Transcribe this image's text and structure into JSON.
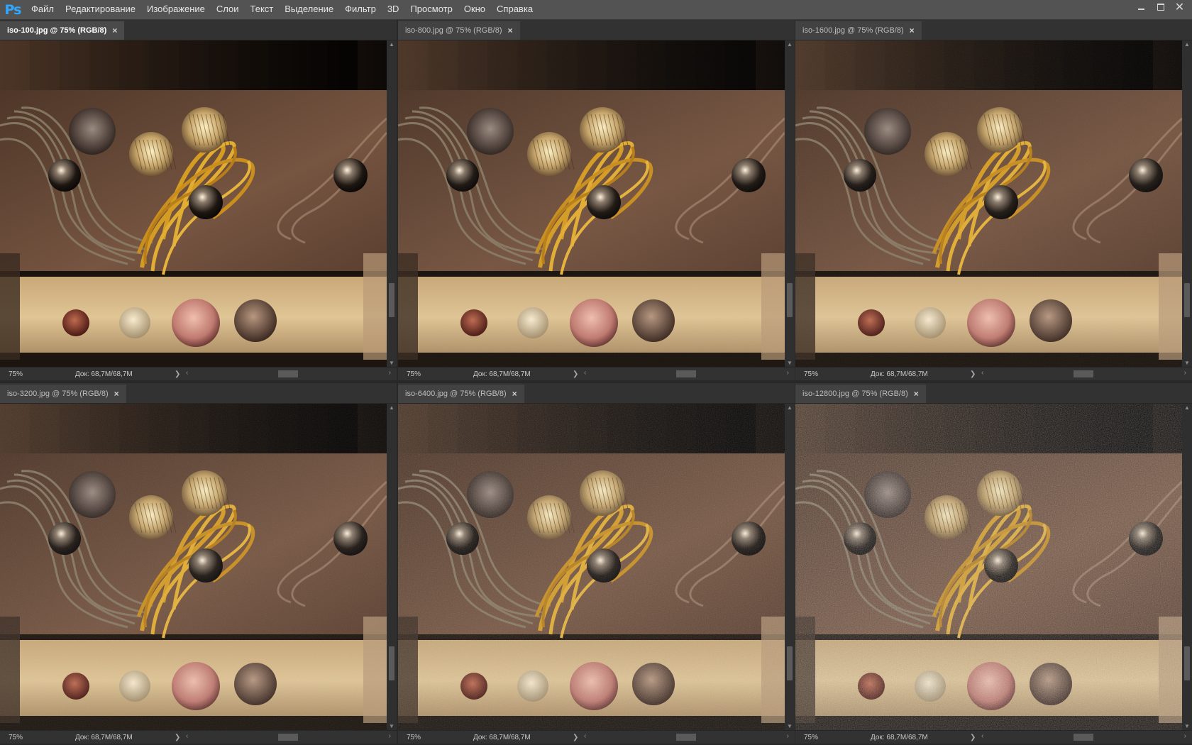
{
  "app": {
    "logo": "Ps",
    "menu": [
      "Файл",
      "Редактирование",
      "Изображение",
      "Слои",
      "Текст",
      "Выделение",
      "Фильтр",
      "3D",
      "Просмотр",
      "Окно",
      "Справка"
    ]
  },
  "window_controls": {
    "minimize": "minimize-icon",
    "restore": "restore-icon",
    "close": "✕"
  },
  "documents": [
    {
      "title": "iso-100.jpg @ 75% (RGB/8)",
      "close": "×",
      "zoom": "75%",
      "doc_size": "Док: 68,7M/68,7M",
      "active": true,
      "noise": 0
    },
    {
      "title": "iso-800.jpg @ 75% (RGB/8)",
      "close": "×",
      "zoom": "75%",
      "doc_size": "Док: 68,7M/68,7M",
      "active": false,
      "noise": 0.05
    },
    {
      "title": "iso-1600.jpg @ 75% (RGB/8)",
      "close": "×",
      "zoom": "75%",
      "doc_size": "Док: 68,7M/68,7M",
      "active": false,
      "noise": 0.1
    },
    {
      "title": "iso-3200.jpg @ 75% (RGB/8)",
      "close": "×",
      "zoom": "75%",
      "doc_size": "Док: 68,7M/68,7M",
      "active": false,
      "noise": 0.15
    },
    {
      "title": "iso-6400.jpg @ 75% (RGB/8)",
      "close": "×",
      "zoom": "75%",
      "doc_size": "Док: 68,7M/68,7M",
      "active": false,
      "noise": 0.25
    },
    {
      "title": "iso-12800.jpg @ 75% (RGB/8)",
      "close": "×",
      "zoom": "75%",
      "doc_size": "Док: 68,7M/68,7M",
      "active": false,
      "noise": 0.45
    }
  ],
  "colors": {
    "backdrop": "#3f2e22",
    "board": "#6a4a37",
    "thread": "#d8a02a",
    "gray_thread": "#7d715e",
    "shelf": "#d9b98b"
  }
}
